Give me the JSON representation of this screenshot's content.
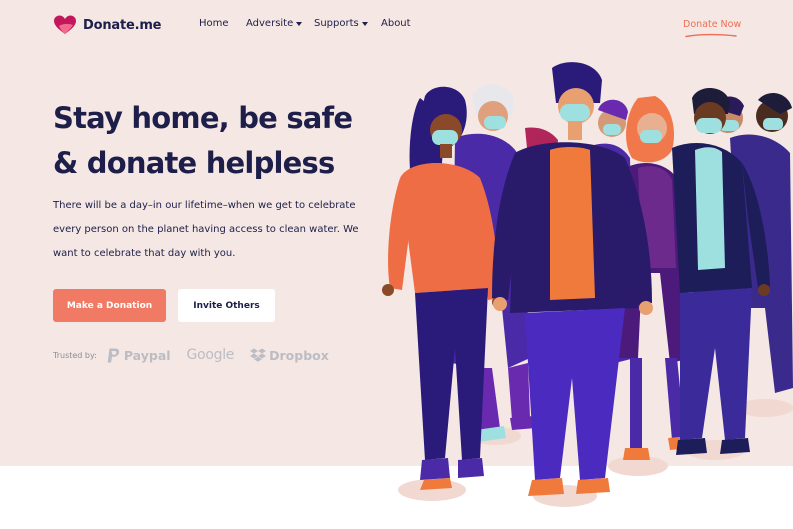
{
  "brand": {
    "name": "Donate.me",
    "logo_icon": "heart-icon"
  },
  "nav": {
    "items": [
      {
        "label": "Home",
        "dropdown": false
      },
      {
        "label": "Adversite",
        "dropdown": true
      },
      {
        "label": "Supports",
        "dropdown": true
      },
      {
        "label": "About",
        "dropdown": false
      }
    ],
    "cta": "Donate Now"
  },
  "hero": {
    "headline_line1": "Stay home, be safe",
    "headline_line2": "& donate helpless",
    "description_lines": [
      "There will be a day–in our lifetime–when we get to celebrate",
      "every person on the planet having access to clean water. We",
      "want to celebrate that day with you."
    ],
    "primary_button": "Make a Donation",
    "secondary_button": "Invite Others"
  },
  "trusted": {
    "label": "Trusted by:",
    "logos": [
      "Paypal",
      "Google",
      "Dropbox"
    ]
  },
  "colors": {
    "hero_bg": "#f5e7e3",
    "navy": "#1d1f4a",
    "accent": "#f07a63",
    "logo_gray": "#bcbdc4"
  }
}
